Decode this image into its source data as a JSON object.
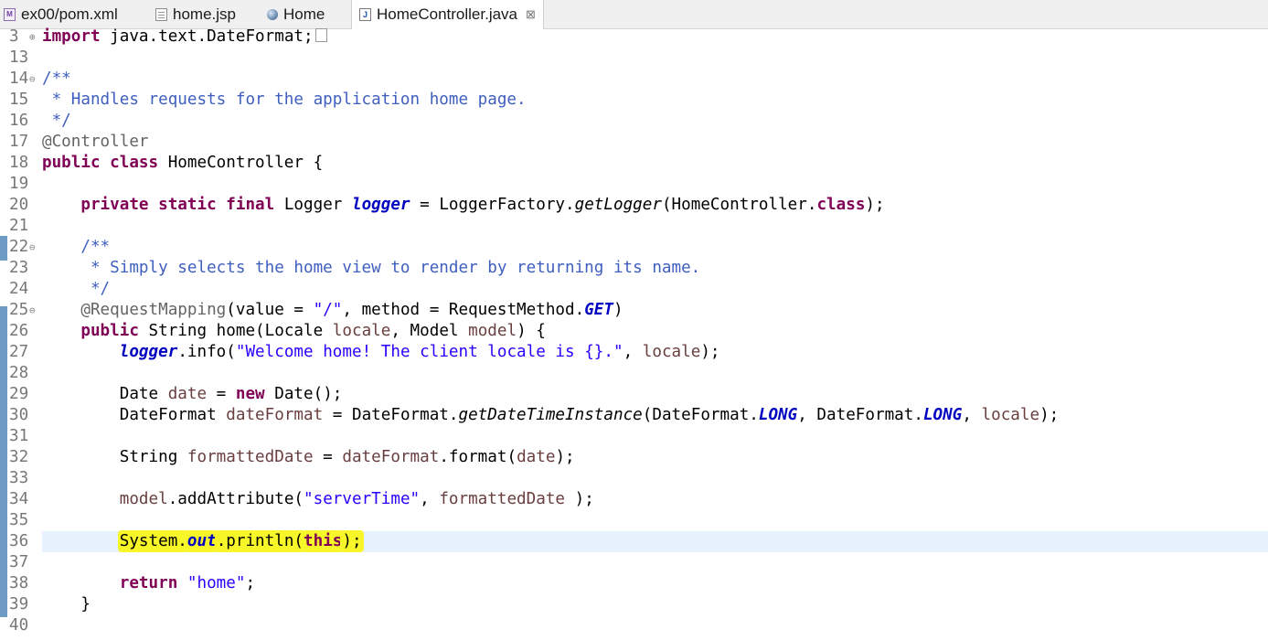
{
  "tabs": [
    {
      "label": "ex00/pom.xml",
      "icon": "pom-xml-icon"
    },
    {
      "label": "home.jsp",
      "icon": "jsp-file-icon"
    },
    {
      "label": "Home",
      "icon": "globe-icon"
    },
    {
      "label": "HomeController.java",
      "icon": "java-file-icon",
      "close": "⊠"
    }
  ],
  "editor": {
    "lines": [
      {
        "num": "3",
        "fold": "⊕",
        "seg": [
          [
            "import",
            "kw"
          ],
          [
            " java.text.DateFormat;",
            ""
          ]
        ]
      },
      {
        "num": "13",
        "seg": []
      },
      {
        "num": "14",
        "fold": "⊖",
        "seg": [
          [
            "/**",
            "cm"
          ]
        ]
      },
      {
        "num": "15",
        "seg": [
          [
            " * Handles requests for the application home page.",
            "cm"
          ]
        ]
      },
      {
        "num": "16",
        "seg": [
          [
            " */",
            "cm"
          ]
        ]
      },
      {
        "num": "17",
        "seg": [
          [
            "@Controller",
            "an"
          ]
        ]
      },
      {
        "num": "18",
        "seg": [
          [
            "public class",
            "kw"
          ],
          [
            " HomeController {",
            ""
          ]
        ]
      },
      {
        "num": "19",
        "seg": []
      },
      {
        "num": "20",
        "seg": [
          [
            "    ",
            ""
          ],
          [
            "private static final",
            "kw"
          ],
          [
            " Logger ",
            ""
          ],
          [
            "logger",
            "fd"
          ],
          [
            " = LoggerFactory.",
            ""
          ],
          [
            "getLogger",
            "it"
          ],
          [
            "(HomeController.",
            ""
          ],
          [
            "class",
            "kw"
          ],
          [
            ");",
            ""
          ]
        ]
      },
      {
        "num": "21",
        "seg": []
      },
      {
        "num": "22",
        "fold": "⊖",
        "seg": [
          [
            "    /**",
            "cm"
          ]
        ]
      },
      {
        "num": "23",
        "seg": [
          [
            "     * Simply selects the home view to render by returning its name.",
            "cm"
          ]
        ]
      },
      {
        "num": "24",
        "seg": [
          [
            "     */",
            "cm"
          ]
        ]
      },
      {
        "num": "25",
        "fold": "⊖",
        "seg": [
          [
            "    ",
            ""
          ],
          [
            "@RequestMapping",
            "an"
          ],
          [
            "(value = ",
            ""
          ],
          [
            "\"/\"",
            "st"
          ],
          [
            ", method = RequestMethod.",
            ""
          ],
          [
            "GET",
            "fd"
          ],
          [
            ")",
            ""
          ]
        ]
      },
      {
        "num": "26",
        "seg": [
          [
            "    ",
            ""
          ],
          [
            "public",
            "kw"
          ],
          [
            " String home(Locale ",
            ""
          ],
          [
            "locale",
            "lv"
          ],
          [
            ", Model ",
            ""
          ],
          [
            "model",
            "lv"
          ],
          [
            ") {",
            ""
          ]
        ]
      },
      {
        "num": "27",
        "seg": [
          [
            "        ",
            ""
          ],
          [
            "logger",
            "fd"
          ],
          [
            ".info(",
            ""
          ],
          [
            "\"Welcome home! The client locale is {}.\"",
            "st"
          ],
          [
            ", ",
            ""
          ],
          [
            "locale",
            "lv"
          ],
          [
            ");",
            ""
          ]
        ]
      },
      {
        "num": "28",
        "seg": []
      },
      {
        "num": "29",
        "seg": [
          [
            "        Date ",
            ""
          ],
          [
            "date",
            "lv"
          ],
          [
            " = ",
            ""
          ],
          [
            "new",
            "kw"
          ],
          [
            " Date();",
            ""
          ]
        ]
      },
      {
        "num": "30",
        "seg": [
          [
            "        DateFormat ",
            ""
          ],
          [
            "dateFormat",
            "lv"
          ],
          [
            " = DateFormat.",
            ""
          ],
          [
            "getDateTimeInstance",
            "it"
          ],
          [
            "(DateFormat.",
            ""
          ],
          [
            "LONG",
            "fd"
          ],
          [
            ", DateFormat.",
            ""
          ],
          [
            "LONG",
            "fd"
          ],
          [
            ", ",
            ""
          ],
          [
            "locale",
            "lv"
          ],
          [
            ");",
            ""
          ]
        ]
      },
      {
        "num": "31",
        "seg": []
      },
      {
        "num": "32",
        "seg": [
          [
            "        String ",
            ""
          ],
          [
            "formattedDate",
            "lv"
          ],
          [
            " = ",
            ""
          ],
          [
            "dateFormat",
            "lv"
          ],
          [
            ".format(",
            ""
          ],
          [
            "date",
            "lv"
          ],
          [
            ");",
            ""
          ]
        ]
      },
      {
        "num": "33",
        "seg": []
      },
      {
        "num": "34",
        "seg": [
          [
            "        ",
            ""
          ],
          [
            "model",
            "lv"
          ],
          [
            ".addAttribute(",
            ""
          ],
          [
            "\"serverTime\"",
            "st"
          ],
          [
            ", ",
            ""
          ],
          [
            "formattedDate",
            "lv"
          ],
          [
            " );",
            ""
          ]
        ]
      },
      {
        "num": "35",
        "seg": []
      },
      {
        "num": "36",
        "current": true,
        "seg": [
          [
            "        ",
            ""
          ],
          [
            "System.",
            "hl"
          ],
          [
            "out",
            "hl fd"
          ],
          [
            ".println(",
            "hl"
          ],
          [
            "this",
            "hl kw"
          ],
          [
            ");",
            "hl"
          ]
        ]
      },
      {
        "num": "37",
        "seg": []
      },
      {
        "num": "38",
        "seg": [
          [
            "        ",
            ""
          ],
          [
            "return",
            "kw"
          ],
          [
            " ",
            ""
          ],
          [
            "\"home\"",
            "st"
          ],
          [
            ";",
            ""
          ]
        ]
      },
      {
        "num": "39",
        "seg": [
          [
            "    }",
            ""
          ]
        ]
      },
      {
        "num": "40",
        "seg": []
      }
    ]
  },
  "colors": {
    "keyword": "#7f0055",
    "comment": "#3f5fbf",
    "string": "#2a00ff",
    "field": "#0000c0",
    "annotation": "#646464",
    "local_var": "#6a3e3e",
    "highlight": "#f6f629",
    "current_line": "#e8f2fe"
  }
}
